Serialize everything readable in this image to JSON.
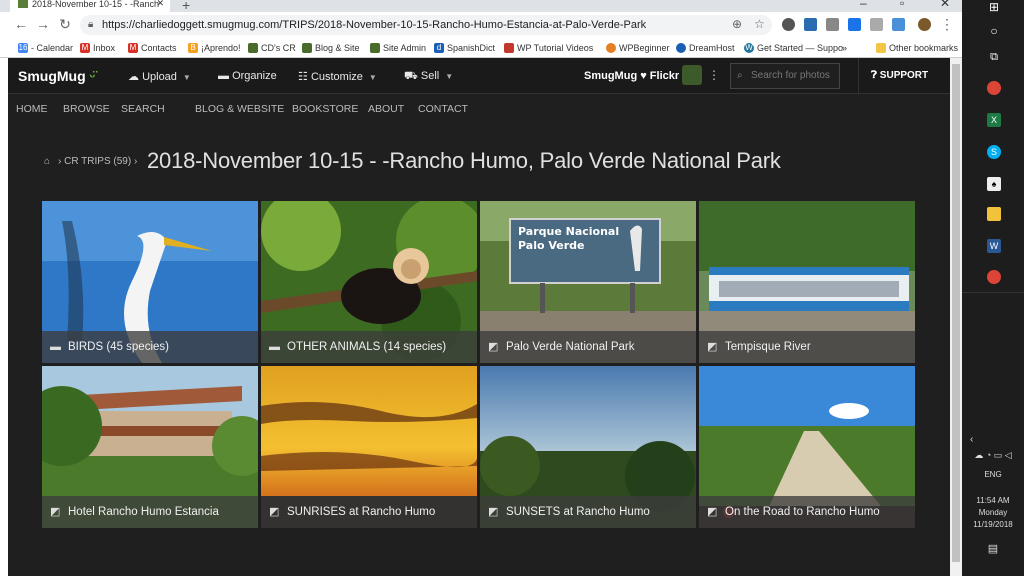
{
  "browser": {
    "tab_title": "2018-November 10-15 - -Ranch",
    "url": "https://charliedoggett.smugmug.com/TRIPS/2018-November-10-15-Rancho-Humo-Estancia-at-Palo-Verde-Park",
    "bookmarks": [
      {
        "label": "- Calendar",
        "color": "#4285f4"
      },
      {
        "label": "Inbox",
        "color": "#d93025"
      },
      {
        "label": "Contacts",
        "color": "#d93025"
      },
      {
        "label": "¡Aprendo!",
        "color": "#f4a020"
      },
      {
        "label": "CD's CR",
        "color": "#4a6b2a"
      },
      {
        "label": "Blog & Site",
        "color": "#4a6b2a"
      },
      {
        "label": "Site Admin",
        "color": "#4a6b2a"
      },
      {
        "label": "SpanishDict",
        "color": "#1a5fb4"
      },
      {
        "label": "WP Tutorial Videos",
        "color": "#c0392b"
      },
      {
        "label": "WPBeginner",
        "color": "#e67e22"
      },
      {
        "label": "DreamHost",
        "color": "#1a5fb4"
      },
      {
        "label": "Get Started — Suppo",
        "color": "#21759b"
      },
      {
        "label": "»",
        "color": ""
      },
      {
        "label": "Other bookmarks",
        "color": "#f4c542"
      }
    ]
  },
  "smugmug": {
    "logo": "SmugMug",
    "menu": {
      "upload": "Upload",
      "organize": "Organize",
      "customize": "Customize",
      "sell": "Sell"
    },
    "brand_link": "SmugMug ♥ Flickr",
    "search_placeholder": "Search for photos",
    "support": "SUPPORT"
  },
  "site_nav": [
    "HOME",
    "BROWSE",
    "SEARCH",
    "BLOG & WEBSITE",
    "BOOKSTORE",
    "ABOUT",
    "CONTACT"
  ],
  "breadcrumb": {
    "parent": "CR TRIPS (59)",
    "separator": "›",
    "title": "2018-November 10-15 - -Rancho Humo, Palo Verde National Park"
  },
  "gallery": [
    {
      "label": "BIRDS (45 species)",
      "kind": "folder"
    },
    {
      "label": "OTHER ANIMALS (14 species)",
      "kind": "folder"
    },
    {
      "label": "Palo Verde National Park",
      "kind": "gallery"
    },
    {
      "label": "Tempisque River",
      "kind": "gallery"
    },
    {
      "label": "Hotel Rancho Humo Estancia",
      "kind": "gallery"
    },
    {
      "label": "SUNRISES at Rancho Humo",
      "kind": "gallery"
    },
    {
      "label": "SUNSETS at Rancho Humo",
      "kind": "gallery"
    },
    {
      "label": "On the Road to Rancho Humo",
      "kind": "gallery"
    }
  ],
  "sign_text": {
    "line1": "Parque Nacional",
    "line2": "Palo Verde"
  },
  "tray": {
    "lang": "ENG",
    "time": "11:54 AM",
    "day": "Monday",
    "date": "11/19/2018"
  }
}
